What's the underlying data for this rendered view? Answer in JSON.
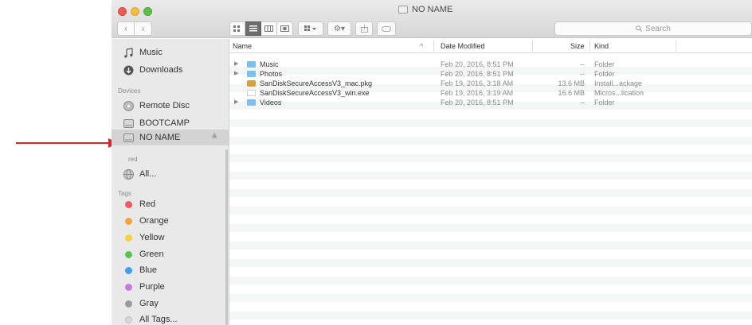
{
  "window": {
    "title": "NO NAME"
  },
  "toolbar": {
    "back_icon": "chevron-left-icon",
    "forward_icon": "chevron-right-icon",
    "view_modes": [
      "icon-view",
      "list-view",
      "column-view",
      "cover-flow-view"
    ],
    "active_view": "list-view",
    "search_placeholder": "Search"
  },
  "sidebar": {
    "favorites": [
      {
        "label": "Music",
        "icon": "music-note-icon"
      },
      {
        "label": "Downloads",
        "icon": "download-icon"
      }
    ],
    "devices_heading": "Devices",
    "devices": [
      {
        "label": "Remote Disc",
        "icon": "disc-icon"
      },
      {
        "label": "BOOTCAMP",
        "icon": "drive-icon"
      },
      {
        "label": "NO NAME",
        "icon": "drive-icon",
        "selected": true,
        "eject": "≜"
      }
    ],
    "shared_heading": "red",
    "shared": [
      {
        "label": "All...",
        "icon": "network-globe-icon"
      }
    ],
    "tags_heading": "Tags",
    "tags": [
      {
        "label": "Red",
        "color": "#f05a5a"
      },
      {
        "label": "Orange",
        "color": "#f6a33b"
      },
      {
        "label": "Yellow",
        "color": "#f3d23b"
      },
      {
        "label": "Green",
        "color": "#58c454"
      },
      {
        "label": "Blue",
        "color": "#3f9ff0"
      },
      {
        "label": "Purple",
        "color": "#c77be0"
      },
      {
        "label": "Gray",
        "color": "#9b9b9b"
      },
      {
        "label": "All Tags...",
        "color": "#d9d9d9"
      }
    ]
  },
  "file_list": {
    "columns": {
      "name": "Name",
      "sort_indicator": "^",
      "date": "Date Modified",
      "size": "Size",
      "kind": "Kind"
    },
    "rows": [
      {
        "disclosure": "▶",
        "icon": "folder-icon",
        "name": "Music",
        "date": "Feb 20, 2016, 8:51 PM",
        "size": "--",
        "kind": "Folder"
      },
      {
        "disclosure": "▶",
        "icon": "folder-icon",
        "name": "Photos",
        "date": "Feb 20, 2016, 8:51 PM",
        "size": "--",
        "kind": "Folder"
      },
      {
        "disclosure": "",
        "icon": "package-icon",
        "name": "SanDiskSecureAccessV3_mac.pkg",
        "date": "Feb 19, 2016, 3:18 AM",
        "size": "13.6 MB",
        "kind": "Install...ackage"
      },
      {
        "disclosure": "",
        "icon": "document-icon",
        "name": "SanDiskSecureAccessV3_win.exe",
        "date": "Feb 19, 2016, 3:19 AM",
        "size": "16.6 MB",
        "kind": "Micros...lication"
      },
      {
        "disclosure": "▶",
        "icon": "folder-icon",
        "name": "Videos",
        "date": "Feb 20, 2016, 8:51 PM",
        "size": "--",
        "kind": "Folder"
      }
    ]
  },
  "annotation": {
    "arrow_color": "#d9262a",
    "arrow_target": "NO NAME"
  }
}
